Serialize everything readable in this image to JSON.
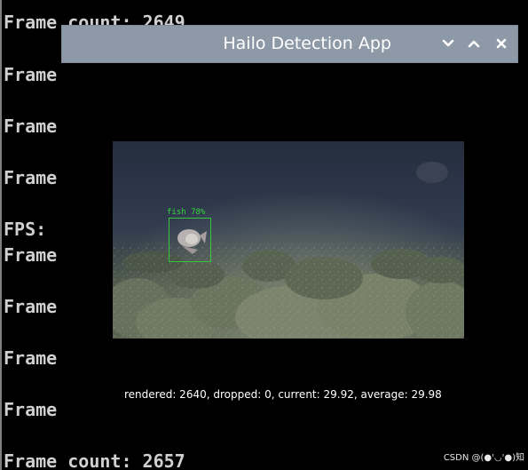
{
  "terminal": {
    "lines": [
      "Frame count: 2649",
      "Frame",
      "Frame",
      "Frame",
      "FPS:",
      "Frame",
      "Frame",
      "Frame",
      "Frame",
      "Frame count: 2657"
    ]
  },
  "window": {
    "title": "Hailo Detection App",
    "minimize_icon": "chevron-down-icon",
    "maximize_icon": "chevron-up-icon",
    "close_icon": "close-icon"
  },
  "video": {
    "detection_label": "fish 78%",
    "stats": "rendered: 2640, dropped: 0, current: 29.92, average: 29.98"
  },
  "watermark": {
    "text": "CSDN @(●'◡'●)知"
  },
  "colors": {
    "titlebar": "#8d99a6",
    "detection": "#37c43f",
    "terminal_text": "#d0d0d0"
  }
}
